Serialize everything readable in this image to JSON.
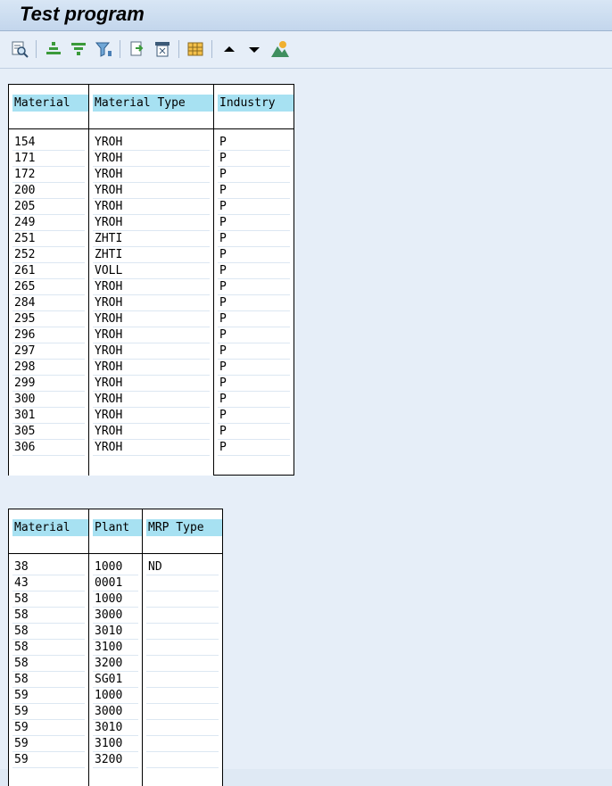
{
  "window": {
    "title": "Test program"
  },
  "toolbar": {
    "buttons": [
      "details-icon",
      "sort-ascending-icon",
      "sort-descending-icon",
      "filter-icon",
      "export-icon",
      "print-preview-icon",
      "layout-grid-icon",
      "arrow-up-icon",
      "arrow-down-icon",
      "graphic-icon"
    ]
  },
  "table1": {
    "headers": [
      "Material",
      "Material Type",
      "Industry"
    ],
    "rows": [
      [
        "154",
        "YROH",
        "P"
      ],
      [
        "171",
        "YROH",
        "P"
      ],
      [
        "172",
        "YROH",
        "P"
      ],
      [
        "200",
        "YROH",
        "P"
      ],
      [
        "205",
        "YROH",
        "P"
      ],
      [
        "249",
        "YROH",
        "P"
      ],
      [
        "251",
        "ZHTI",
        "P"
      ],
      [
        "252",
        "ZHTI",
        "P"
      ],
      [
        "261",
        "VOLL",
        "P"
      ],
      [
        "265",
        "YROH",
        "P"
      ],
      [
        "284",
        "YROH",
        "P"
      ],
      [
        "295",
        "YROH",
        "P"
      ],
      [
        "296",
        "YROH",
        "P"
      ],
      [
        "297",
        "YROH",
        "P"
      ],
      [
        "298",
        "YROH",
        "P"
      ],
      [
        "299",
        "YROH",
        "P"
      ],
      [
        "300",
        "YROH",
        "P"
      ],
      [
        "301",
        "YROH",
        "P"
      ],
      [
        "305",
        "YROH",
        "P"
      ],
      [
        "306",
        "YROH",
        "P"
      ]
    ]
  },
  "table2": {
    "headers": [
      "Material",
      "Plant",
      "MRP Type"
    ],
    "rows": [
      [
        "38",
        "1000",
        "ND"
      ],
      [
        "43",
        "0001",
        ""
      ],
      [
        "58",
        "1000",
        ""
      ],
      [
        "58",
        "3000",
        ""
      ],
      [
        "58",
        "3010",
        ""
      ],
      [
        "58",
        "3100",
        ""
      ],
      [
        "58",
        "3200",
        ""
      ],
      [
        "58",
        "SG01",
        ""
      ],
      [
        "59",
        "1000",
        ""
      ],
      [
        "59",
        "3000",
        ""
      ],
      [
        "59",
        "3010",
        ""
      ],
      [
        "59",
        "3100",
        ""
      ],
      [
        "59",
        "3200",
        ""
      ]
    ]
  }
}
